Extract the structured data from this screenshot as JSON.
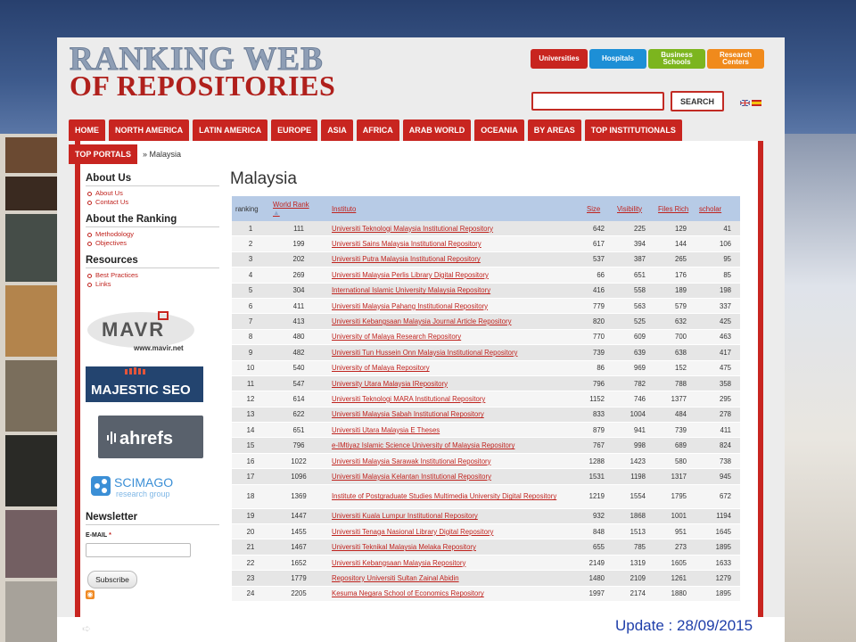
{
  "logo": {
    "line1": "RANKING WEB",
    "line2": "OF REPOSITORIES"
  },
  "top_buttons": [
    {
      "label": "Universities",
      "color": "#c8251f"
    },
    {
      "label": "Hospitals",
      "color": "#1d8fd6"
    },
    {
      "label": "Business Schools",
      "color": "#7cb51e"
    },
    {
      "label": "Research Centers",
      "color": "#f08a1c"
    }
  ],
  "search": {
    "button": "SEARCH",
    "value": ""
  },
  "nav": [
    "HOME",
    "NORTH AMERICA",
    "LATIN AMERICA",
    "EUROPE",
    "ASIA",
    "AFRICA",
    "ARAB WORLD",
    "OCEANIA",
    "BY AREAS",
    "TOP INSTITUTIONALS"
  ],
  "nav_second": "TOP PORTALS",
  "breadcrumb": "» Malaysia",
  "sidebar": {
    "about_us": {
      "title": "About Us",
      "items": [
        "About Us",
        "Contact Us"
      ]
    },
    "about_ranking": {
      "title": "About the Ranking",
      "items": [
        "Methodology",
        "Objectives"
      ]
    },
    "resources": {
      "title": "Resources",
      "items": [
        "Best Practices",
        "Links"
      ]
    },
    "sponsors": {
      "mavir": "www.mavir.net",
      "majestic": "MAJESTIC SEO",
      "ahrefs": "ahrefs",
      "scimago": "SCIMAGO",
      "scimago_sub": "research group"
    },
    "newsletter": {
      "title": "Newsletter",
      "email_label": "E-MAIL",
      "required": "*",
      "subscribe": "Subscribe"
    }
  },
  "main": {
    "title": "Malaysia",
    "headers": {
      "ranking": "ranking",
      "world_rank": "World Rank",
      "instituto": "Instituto",
      "size": "Size",
      "visibility": "Visibility",
      "files_rich": "Files Rich",
      "scholar": "scholar"
    },
    "rows": [
      {
        "ranking": "1",
        "world": "111",
        "inst": "Universiti Teknologi Malaysia Institutional Repository",
        "size": "642",
        "vis": "225",
        "files": "129",
        "scholar": "41"
      },
      {
        "ranking": "2",
        "world": "199",
        "inst": "Universiti Sains Malaysia Institutional Repository",
        "size": "617",
        "vis": "394",
        "files": "144",
        "scholar": "106"
      },
      {
        "ranking": "3",
        "world": "202",
        "inst": "Universiti Putra Malaysia Institutional Repository",
        "size": "537",
        "vis": "387",
        "files": "265",
        "scholar": "95"
      },
      {
        "ranking": "4",
        "world": "269",
        "inst": "Universiti Malaysia Perlis Library Digital Repository",
        "size": "66",
        "vis": "651",
        "files": "176",
        "scholar": "85"
      },
      {
        "ranking": "5",
        "world": "304",
        "inst": "International Islamic University Malaysia Repository",
        "size": "416",
        "vis": "558",
        "files": "189",
        "scholar": "198"
      },
      {
        "ranking": "6",
        "world": "411",
        "inst": "Universiti Malaysia Pahang Institutional Repository",
        "size": "779",
        "vis": "563",
        "files": "579",
        "scholar": "337"
      },
      {
        "ranking": "7",
        "world": "413",
        "inst": "Universiti Kebangsaan Malaysia Journal Article Repository",
        "size": "820",
        "vis": "525",
        "files": "632",
        "scholar": "425"
      },
      {
        "ranking": "8",
        "world": "480",
        "inst": "University of Malaya Research Repository",
        "size": "770",
        "vis": "609",
        "files": "700",
        "scholar": "463"
      },
      {
        "ranking": "9",
        "world": "482",
        "inst": "Universiti Tun Hussein Onn Malaysia Institutional Repository",
        "size": "739",
        "vis": "639",
        "files": "638",
        "scholar": "417"
      },
      {
        "ranking": "10",
        "world": "540",
        "inst": "University of Malaya Repository",
        "size": "86",
        "vis": "969",
        "files": "152",
        "scholar": "475"
      },
      {
        "ranking": "11",
        "world": "547",
        "inst": "University Utara Malaysia IRepository",
        "size": "796",
        "vis": "782",
        "files": "788",
        "scholar": "358"
      },
      {
        "ranking": "12",
        "world": "614",
        "inst": "Universiti Teknologi MARA Institutional Repository",
        "size": "1152",
        "vis": "746",
        "files": "1377",
        "scholar": "295"
      },
      {
        "ranking": "13",
        "world": "622",
        "inst": "Universiti Malaysia Sabah Institutional Repository",
        "size": "833",
        "vis": "1004",
        "files": "484",
        "scholar": "278"
      },
      {
        "ranking": "14",
        "world": "651",
        "inst": "Universiti Utara Malaysia E Theses",
        "size": "879",
        "vis": "941",
        "files": "739",
        "scholar": "411"
      },
      {
        "ranking": "15",
        "world": "796",
        "inst": "e-IMtiyaz Islamic Science University of Malaysia Repository",
        "size": "767",
        "vis": "998",
        "files": "689",
        "scholar": "824"
      },
      {
        "ranking": "16",
        "world": "1022",
        "inst": "Universiti Malaysia Sarawak Institutional Repository",
        "size": "1288",
        "vis": "1423",
        "files": "580",
        "scholar": "738"
      },
      {
        "ranking": "17",
        "world": "1096",
        "inst": "Universiti Malaysia Kelantan Institutional Repository",
        "size": "1531",
        "vis": "1198",
        "files": "1317",
        "scholar": "945"
      },
      {
        "ranking": "18",
        "world": "1369",
        "inst": "Institute of Postgraduate Studies Multimedia University Digital Repository",
        "size": "1219",
        "vis": "1554",
        "files": "1795",
        "scholar": "672"
      },
      {
        "ranking": "19",
        "world": "1447",
        "inst": "Universiti Kuala Lumpur Institutional Repository",
        "size": "932",
        "vis": "1868",
        "files": "1001",
        "scholar": "1194"
      },
      {
        "ranking": "20",
        "world": "1455",
        "inst": "Universiti Tenaga Nasional Library Digital Repository",
        "size": "848",
        "vis": "1513",
        "files": "951",
        "scholar": "1645"
      },
      {
        "ranking": "21",
        "world": "1467",
        "inst": "Universiti Teknikal Malaysia Melaka Repository",
        "size": "655",
        "vis": "785",
        "files": "273",
        "scholar": "1895"
      },
      {
        "ranking": "22",
        "world": "1652",
        "inst": "Universiti Kebangsaan Malaysia Repository",
        "size": "2149",
        "vis": "1319",
        "files": "1605",
        "scholar": "1633"
      },
      {
        "ranking": "23",
        "world": "1779",
        "inst": "Repository Universiti Sultan Zainal Abidin",
        "size": "1480",
        "vis": "2109",
        "files": "1261",
        "scholar": "1279"
      },
      {
        "ranking": "24",
        "world": "2205",
        "inst": "Kesuma Negara School of Economics Repository",
        "size": "1997",
        "vis": "2174",
        "files": "1880",
        "scholar": "1895"
      }
    ]
  },
  "update_text": "Update : 28/09/2015",
  "colors": {
    "accent": "#c8251f",
    "header_blue": "#b7cbe6",
    "link": "#c0231e"
  }
}
